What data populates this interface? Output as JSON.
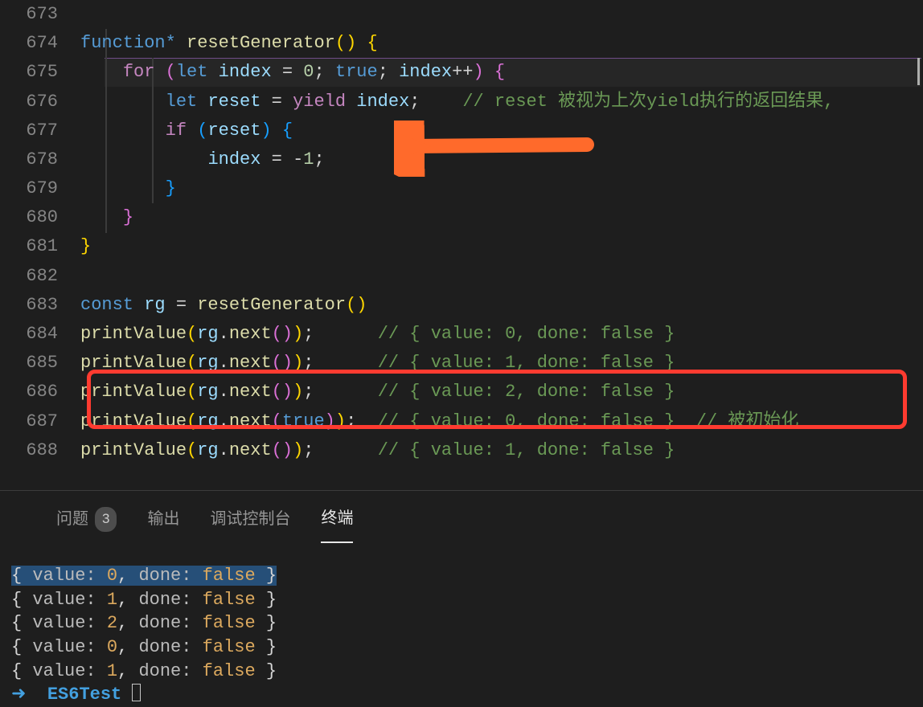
{
  "editor": {
    "lines": [
      {
        "num": "673",
        "html": ""
      },
      {
        "num": "674",
        "html": "<span class='kw1'>function</span><span class='kw1'>*</span> <span class='fn'>resetGenerator</span><span class='par'>(</span><span class='par'>)</span> <span class='par'>{</span>"
      },
      {
        "num": "675",
        "html": "    <span class='kw2'>for</span> <span class='par2'>(</span><span class='kw1'>let</span> <span class='var'>index</span> <span class='op'>=</span> <span class='num'>0</span><span class='punc'>;</span> <span class='bool'>true</span><span class='punc'>;</span> <span class='var'>index</span><span class='op'>++</span><span class='par2'>)</span> <span class='par2'>{</span>"
      },
      {
        "num": "676",
        "html": "        <span class='kw1'>let</span> <span class='var'>reset</span> <span class='op'>=</span> <span class='kw2'>yield</span> <span class='var'>index</span><span class='punc'>;</span>    <span class='cmt'>// reset 被视为上次yield执行的返回结果,</span>"
      },
      {
        "num": "677",
        "html": "        <span class='kw2'>if</span> <span class='par3'>(</span><span class='var'>reset</span><span class='par3'>)</span> <span class='par3'>{</span>"
      },
      {
        "num": "678",
        "html": "            <span class='var'>index</span> <span class='op'>=</span> <span class='op'>-</span><span class='num'>1</span><span class='punc'>;</span>"
      },
      {
        "num": "679",
        "html": "        <span class='par3'>}</span>"
      },
      {
        "num": "680",
        "html": "    <span class='par2'>}</span>"
      },
      {
        "num": "681",
        "html": "<span class='par'>}</span>"
      },
      {
        "num": "682",
        "html": ""
      },
      {
        "num": "683",
        "html": "<span class='kw1'>const</span> <span class='var'>rg</span> <span class='op'>=</span> <span class='fn'>resetGenerator</span><span class='par'>(</span><span class='par'>)</span>"
      },
      {
        "num": "684",
        "html": "<span class='fn'>printValue</span><span class='par'>(</span><span class='var'>rg</span><span class='punc'>.</span><span class='fn'>next</span><span class='par2'>(</span><span class='par2'>)</span><span class='par'>)</span><span class='punc'>;</span>      <span class='cmt'>// { value: 0, done: false }</span>"
      },
      {
        "num": "685",
        "html": "<span class='fn'>printValue</span><span class='par'>(</span><span class='var'>rg</span><span class='punc'>.</span><span class='fn'>next</span><span class='par2'>(</span><span class='par2'>)</span><span class='par'>)</span><span class='punc'>;</span>      <span class='cmt'>// { value: 1, done: false }</span>"
      },
      {
        "num": "686",
        "html": "<span class='fn'>printValue</span><span class='par'>(</span><span class='var'>rg</span><span class='punc'>.</span><span class='fn'>next</span><span class='par2'>(</span><span class='par2'>)</span><span class='par'>)</span><span class='punc'>;</span>      <span class='cmt'>// { value: 2, done: false }</span>"
      },
      {
        "num": "687",
        "html": "<span class='fn'>printValue</span><span class='par'>(</span><span class='var'>rg</span><span class='punc'>.</span><span class='fn'>next</span><span class='par2'>(</span><span class='bool'>true</span><span class='par2'>)</span><span class='par'>)</span><span class='punc'>;</span>  <span class='cmt'>// { value: 0, done: false }</span>  <span class='cmt'>// 被初始化</span>"
      },
      {
        "num": "688",
        "html": "<span class='fn'>printValue</span><span class='par'>(</span><span class='var'>rg</span><span class='punc'>.</span><span class='fn'>next</span><span class='par2'>(</span><span class='par2'>)</span><span class='par'>)</span><span class='punc'>;</span>      <span class='cmt'>// { value: 1, done: false }</span>"
      }
    ],
    "annotations": {
      "highlighted_line": 676,
      "arrow_points_to_line": 678,
      "red_box_line": 687
    }
  },
  "panel": {
    "tabs": {
      "problems": {
        "label": "问题",
        "badge": "3"
      },
      "output": {
        "label": "输出"
      },
      "debug": {
        "label": "调试控制台"
      },
      "terminal": {
        "label": "终端",
        "active": true
      }
    }
  },
  "terminal": {
    "lines": [
      "{ value: 0, done: false }",
      "{ value: 1, done: false }",
      "{ value: 2, done: false }",
      "{ value: 0, done: false }",
      "{ value: 1, done: false }"
    ],
    "prompt_dir": "ES6Test",
    "selected_line_index": 0
  }
}
